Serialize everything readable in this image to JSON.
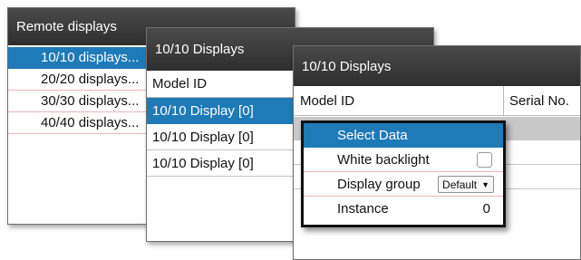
{
  "window1": {
    "title": "Remote displays",
    "items": [
      {
        "label": "10/10 displays..."
      },
      {
        "label": "20/20 displays..."
      },
      {
        "label": "30/30 displays..."
      },
      {
        "label": "40/40 displays..."
      }
    ]
  },
  "window2": {
    "title": "10/10 Displays",
    "column_header": "Model ID",
    "rows": [
      {
        "label": "10/10 Display [0]"
      },
      {
        "label": "10/10 Display [0]"
      },
      {
        "label": "10/10 Display [0]"
      }
    ]
  },
  "window3": {
    "title": "10/10 Displays",
    "columns": {
      "model": "Model ID",
      "serial": "Serial No."
    }
  },
  "popup": {
    "select_data": "Select Data",
    "white_backlight": "White backlight",
    "display_group": "Display group",
    "display_group_value": "Default",
    "instance": "Instance",
    "instance_value": "0"
  },
  "colors": {
    "selection": "#1f7ab8",
    "titlebar": "#3a3a3a"
  }
}
